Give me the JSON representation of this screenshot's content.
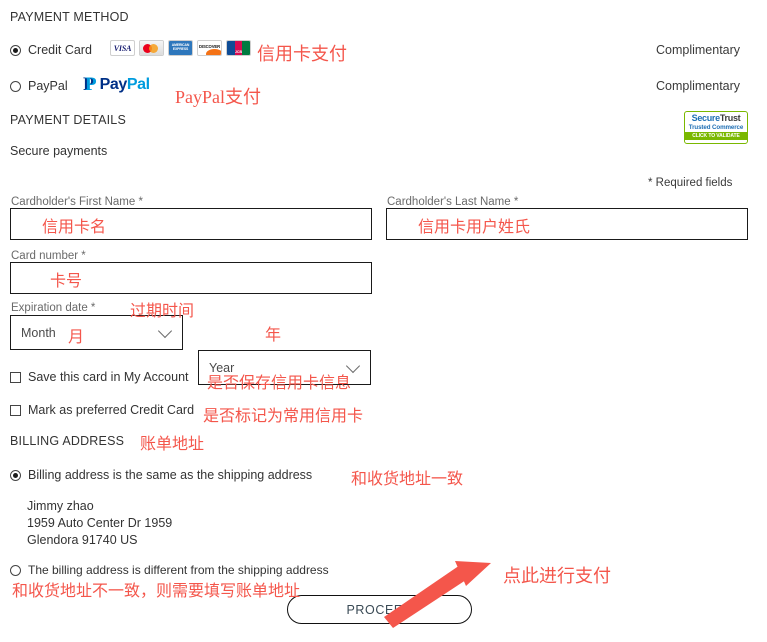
{
  "payment_method": {
    "heading": "PAYMENT METHOD",
    "options": [
      {
        "label": "Credit Card",
        "selected": true,
        "price_label": "Complimentary",
        "card_brands": [
          "VISA",
          "MasterCard",
          "AMERICAN EXPRESS",
          "DISCOVER",
          "JCB"
        ]
      },
      {
        "label": "PayPal",
        "selected": false,
        "price_label": "Complimentary",
        "logo_text": {
          "pay": "Pay",
          "pal": "Pal",
          "mark": "P"
        }
      }
    ]
  },
  "payment_details": {
    "heading": "PAYMENT DETAILS",
    "secure_text": "Secure payments",
    "required_note": "* Required fields",
    "badge": {
      "line1_a": "Secure",
      "line1_b": "Trust",
      "line2": "Trusted Commerce",
      "line3": "CLICK TO VALIDATE"
    },
    "fields": {
      "first_name": {
        "label": "Cardholder's First Name *",
        "value": ""
      },
      "last_name": {
        "label": "Cardholder's Last Name *",
        "value": ""
      },
      "card_number": {
        "label": "Card number *",
        "value": ""
      },
      "expiration": {
        "label": "Expiration date *",
        "month": {
          "selected": "Month"
        },
        "year": {
          "selected": "Year"
        }
      }
    },
    "checkboxes": [
      {
        "label": "Save this card in My Account",
        "checked": false
      },
      {
        "label": "Mark as preferred Credit Card",
        "checked": false
      }
    ]
  },
  "billing_address": {
    "heading": "BILLING ADDRESS",
    "options": [
      {
        "label": "Billing address is the same as the shipping address",
        "selected": true
      },
      {
        "label": "The billing address is different from the shipping address",
        "selected": false
      }
    ],
    "address": {
      "name": "Jimmy zhao",
      "street": "1959 Auto Center Dr 1959",
      "city_zip_country": "Glendora 91740 US"
    }
  },
  "actions": {
    "proceed_label": "PROCEED"
  },
  "annotations": {
    "color": "#f4564b",
    "credit_card": "信用卡支付",
    "paypal": "PayPal支付",
    "first_name": "信用卡名",
    "last_name": "信用卡用户姓氏",
    "card_number": "卡号",
    "expiration": "过期时间",
    "month": "月",
    "year": "年",
    "save_card": "是否保存信用卡信息",
    "preferred_card": "是否标记为常用信用卡",
    "billing_address": "账单地址",
    "same_address": "和收货地址一致",
    "different_address": "和收货地址不一致，则需要填写账单地址",
    "proceed": "点此进行支付"
  }
}
